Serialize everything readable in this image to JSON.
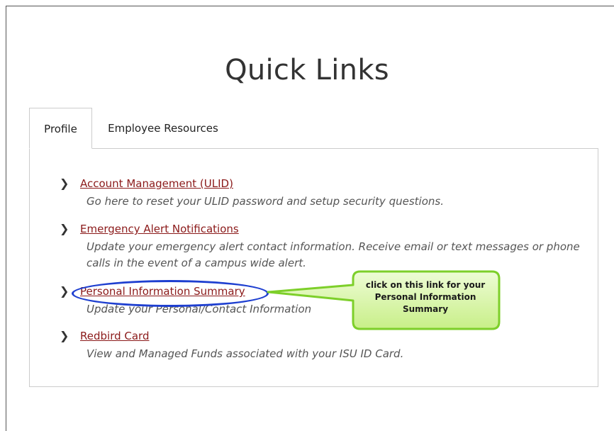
{
  "page": {
    "title": "Quick Links"
  },
  "tabs": [
    {
      "label": "Profile",
      "active": true
    },
    {
      "label": "Employee Resources",
      "active": false
    }
  ],
  "links": [
    {
      "label": "Account Management (ULID)",
      "description": "Go here to reset your ULID password and setup security questions."
    },
    {
      "label": "Emergency Alert Notifications",
      "description": "Update your emergency alert contact information. Receive email or text messages or phone calls in the event of a campus wide alert."
    },
    {
      "label": "Personal Information Summary",
      "description": "Update your Personal/Contact Information"
    },
    {
      "label": "Redbird Card",
      "description": "View and Managed Funds associated with your ISU ID Card."
    }
  ],
  "callout": {
    "text": "click on this link for your Personal Information Summary"
  },
  "icons": {
    "bullet": "chevron-right-icon"
  },
  "colors": {
    "link": "#8b1a1a",
    "highlight_circle": "#1e3fd0",
    "callout_fill": "#d6f5a0",
    "callout_border": "#7dcf2a"
  }
}
